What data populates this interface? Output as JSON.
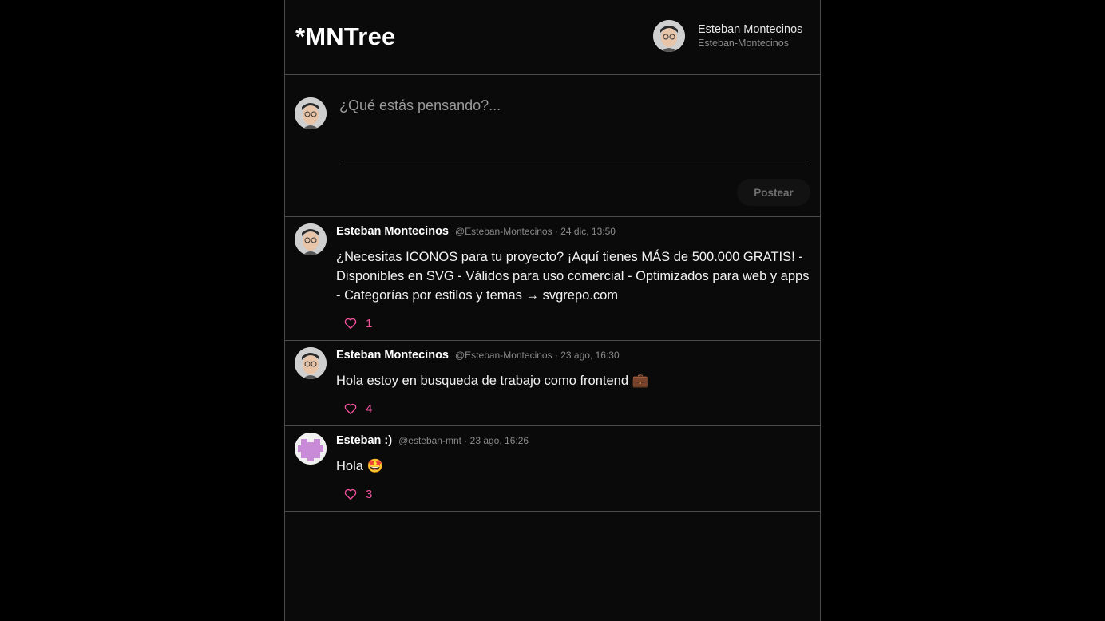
{
  "app": {
    "title": "*MNTree"
  },
  "current_user": {
    "name": "Esteban Montecinos",
    "handle": "Esteban-Montecinos"
  },
  "composer": {
    "placeholder": "¿Qué estás pensando?...",
    "submit_label": "Postear"
  },
  "posts": [
    {
      "author": "Esteban Montecinos",
      "meta": "@Esteban-Montecinos · 24 dic, 13:50",
      "body": "¿Necesitas ICONOS para tu proyecto? ¡Aquí tienes MÁS de 500.000 GRATIS! - Disponibles en SVG - Válidos para uso comercial - Optimizados para web y apps - Categorías por estilos y temas → svgrepo.com",
      "likes": "1",
      "avatar": "photo"
    },
    {
      "author": "Esteban Montecinos",
      "meta": "@Esteban-Montecinos · 23 ago, 16:30",
      "body": "Hola estoy en busqueda de trabajo como frontend 💼",
      "likes": "4",
      "avatar": "photo"
    },
    {
      "author": "Esteban :)",
      "meta": "@esteban-mnt · 23 ago, 16:26",
      "body": "Hola 🤩",
      "likes": "3",
      "avatar": "identicon"
    }
  ],
  "colors": {
    "accent": "#f0529c",
    "background": "#0a0a0a",
    "border": "#4a4a4a"
  },
  "icons": {
    "like": "heart-icon"
  }
}
